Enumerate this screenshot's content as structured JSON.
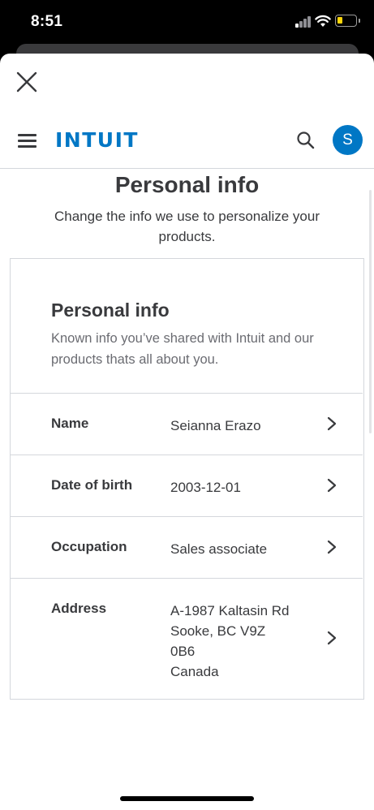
{
  "status_bar": {
    "time": "8:51"
  },
  "header": {
    "logo": "INTUIT",
    "avatar_initial": "S"
  },
  "page": {
    "title": "Personal info",
    "subtitle": "Change the info we use to personalize your products."
  },
  "card": {
    "title": "Personal info",
    "description": "Known info you’ve shared with Intuit and our products thats all about you.",
    "rows": [
      {
        "label": "Name",
        "value": "Seianna Erazo"
      },
      {
        "label": "Date of birth",
        "value": "2003-12-01"
      },
      {
        "label": "Occupation",
        "value": "Sales associate"
      },
      {
        "label": "Address",
        "value_lines": [
          "A-1987 Kaltasin Rd",
          "Sooke, BC V9Z",
          "0B6",
          "Canada"
        ]
      }
    ]
  },
  "icons": {
    "close": "close-icon",
    "menu": "hamburger-menu-icon",
    "search": "search-icon",
    "chevron": "chevron-right-icon"
  },
  "colors": {
    "brand": "#0077c5",
    "text": "#393a3d",
    "muted": "#6b6c72",
    "divider": "#d4d7dc"
  }
}
